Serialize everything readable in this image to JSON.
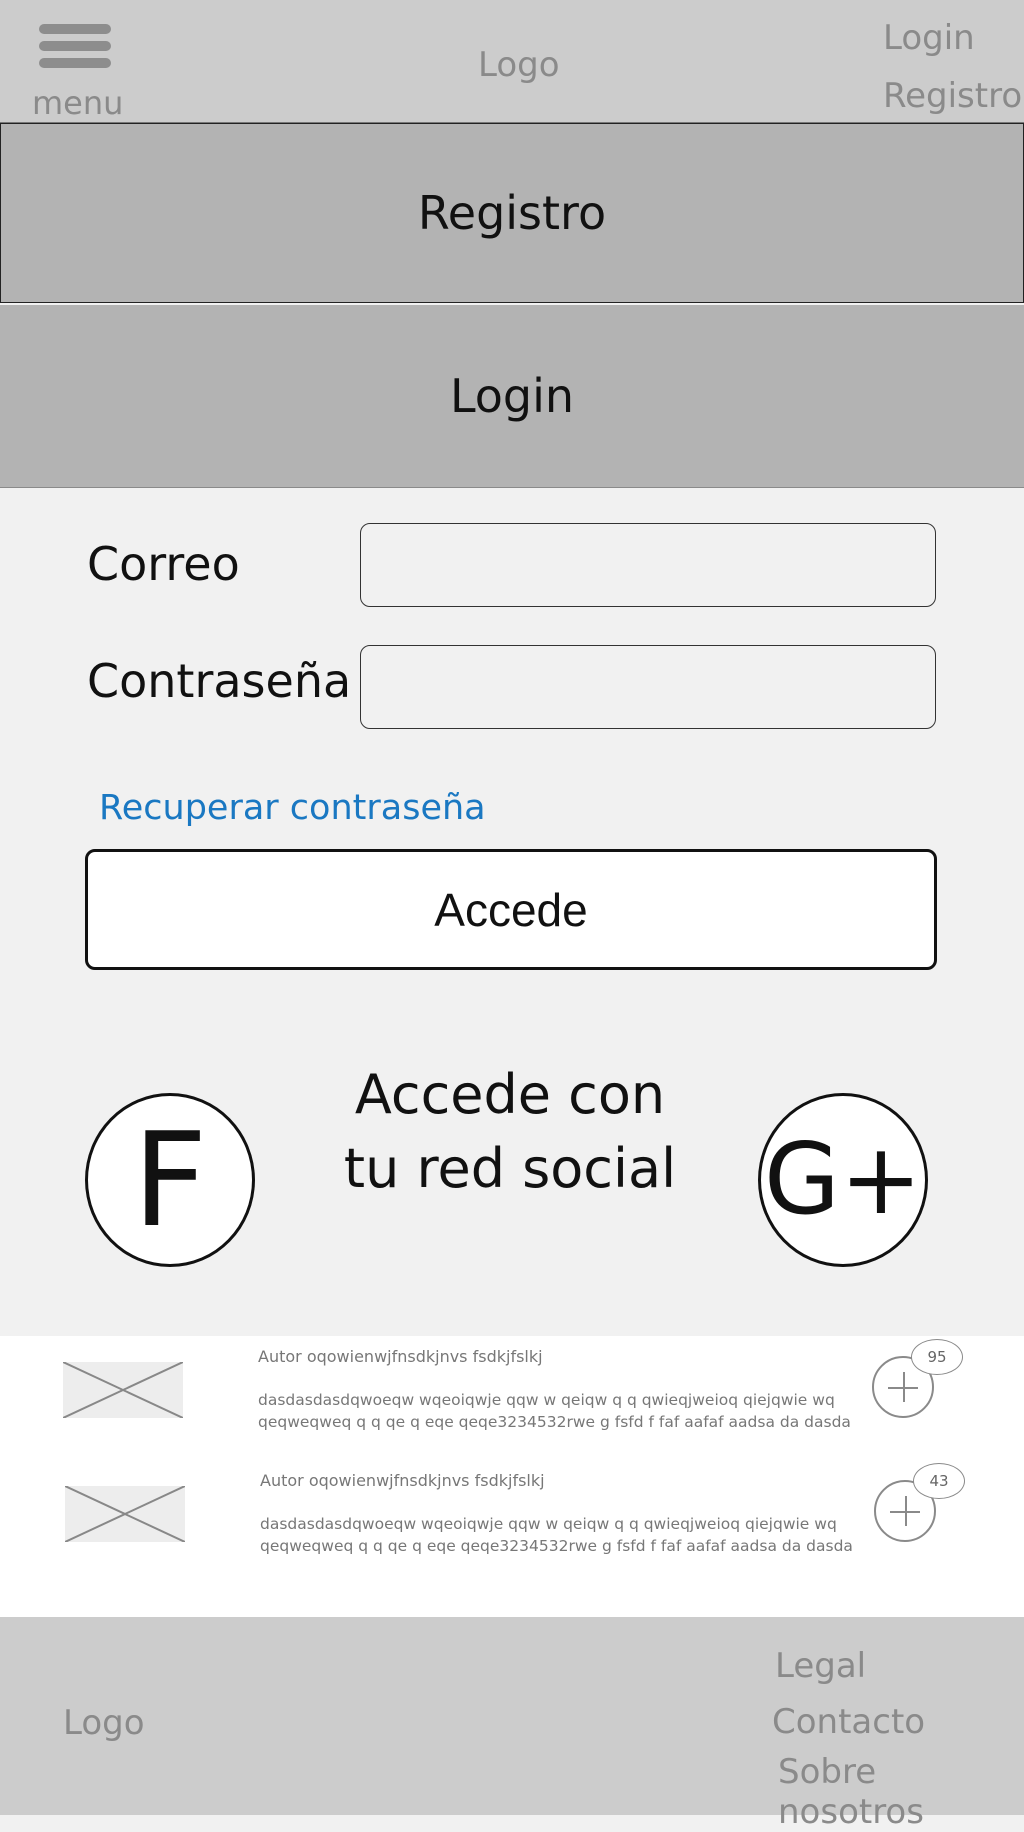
{
  "header": {
    "menu_label": "menu",
    "logo": "Logo",
    "login_link": "Login",
    "registro_link": "Registro"
  },
  "tabs": {
    "registro": "Registro",
    "login": "Login"
  },
  "form": {
    "correo_label": "Correo",
    "correo_value": "",
    "password_label": "Contraseña",
    "password_value": "",
    "recover_link": "Recuperar contraseña",
    "submit_label": "Accede"
  },
  "social": {
    "title_line1": "Accede con",
    "title_line2": "tu red social",
    "facebook_label": "F",
    "google_label": "G+"
  },
  "items": [
    {
      "author": "Autor oqowienwjfnsdkjnvs fsdkjfslkj",
      "text_line1": "dasdasdasdqwoeqw wqeoiqwje qqw  w qeiqw  q  q qwieqjweioq qiejqwie wq",
      "text_line2": "qeqweqweq q  q qe q eqe qeqe3234532rwe g fsfd f faf aafaf aadsa da dasda",
      "count": "95"
    },
    {
      "author": "Autor oqowienwjfnsdkjnvs fsdkjfslkj",
      "text_line1": "dasdasdasdqwoeqw wqeoiqwje qqw  w qeiqw  q  q qwieqjweioq qiejqwie wq",
      "text_line2": "qeqweqweq q  q qe q eqe qeqe3234532rwe g fsfd f faf aafaf aadsa da dasda",
      "count": "43"
    }
  ],
  "footer": {
    "logo": "Logo",
    "legal": "Legal",
    "contacto": "Contacto",
    "sobre": "Sobre nosotros"
  },
  "colors": {
    "header_bg": "#cccccc",
    "tab_bg": "#b3b3b3",
    "page_bg": "#f1f1f1",
    "link": "#1a78c2"
  }
}
